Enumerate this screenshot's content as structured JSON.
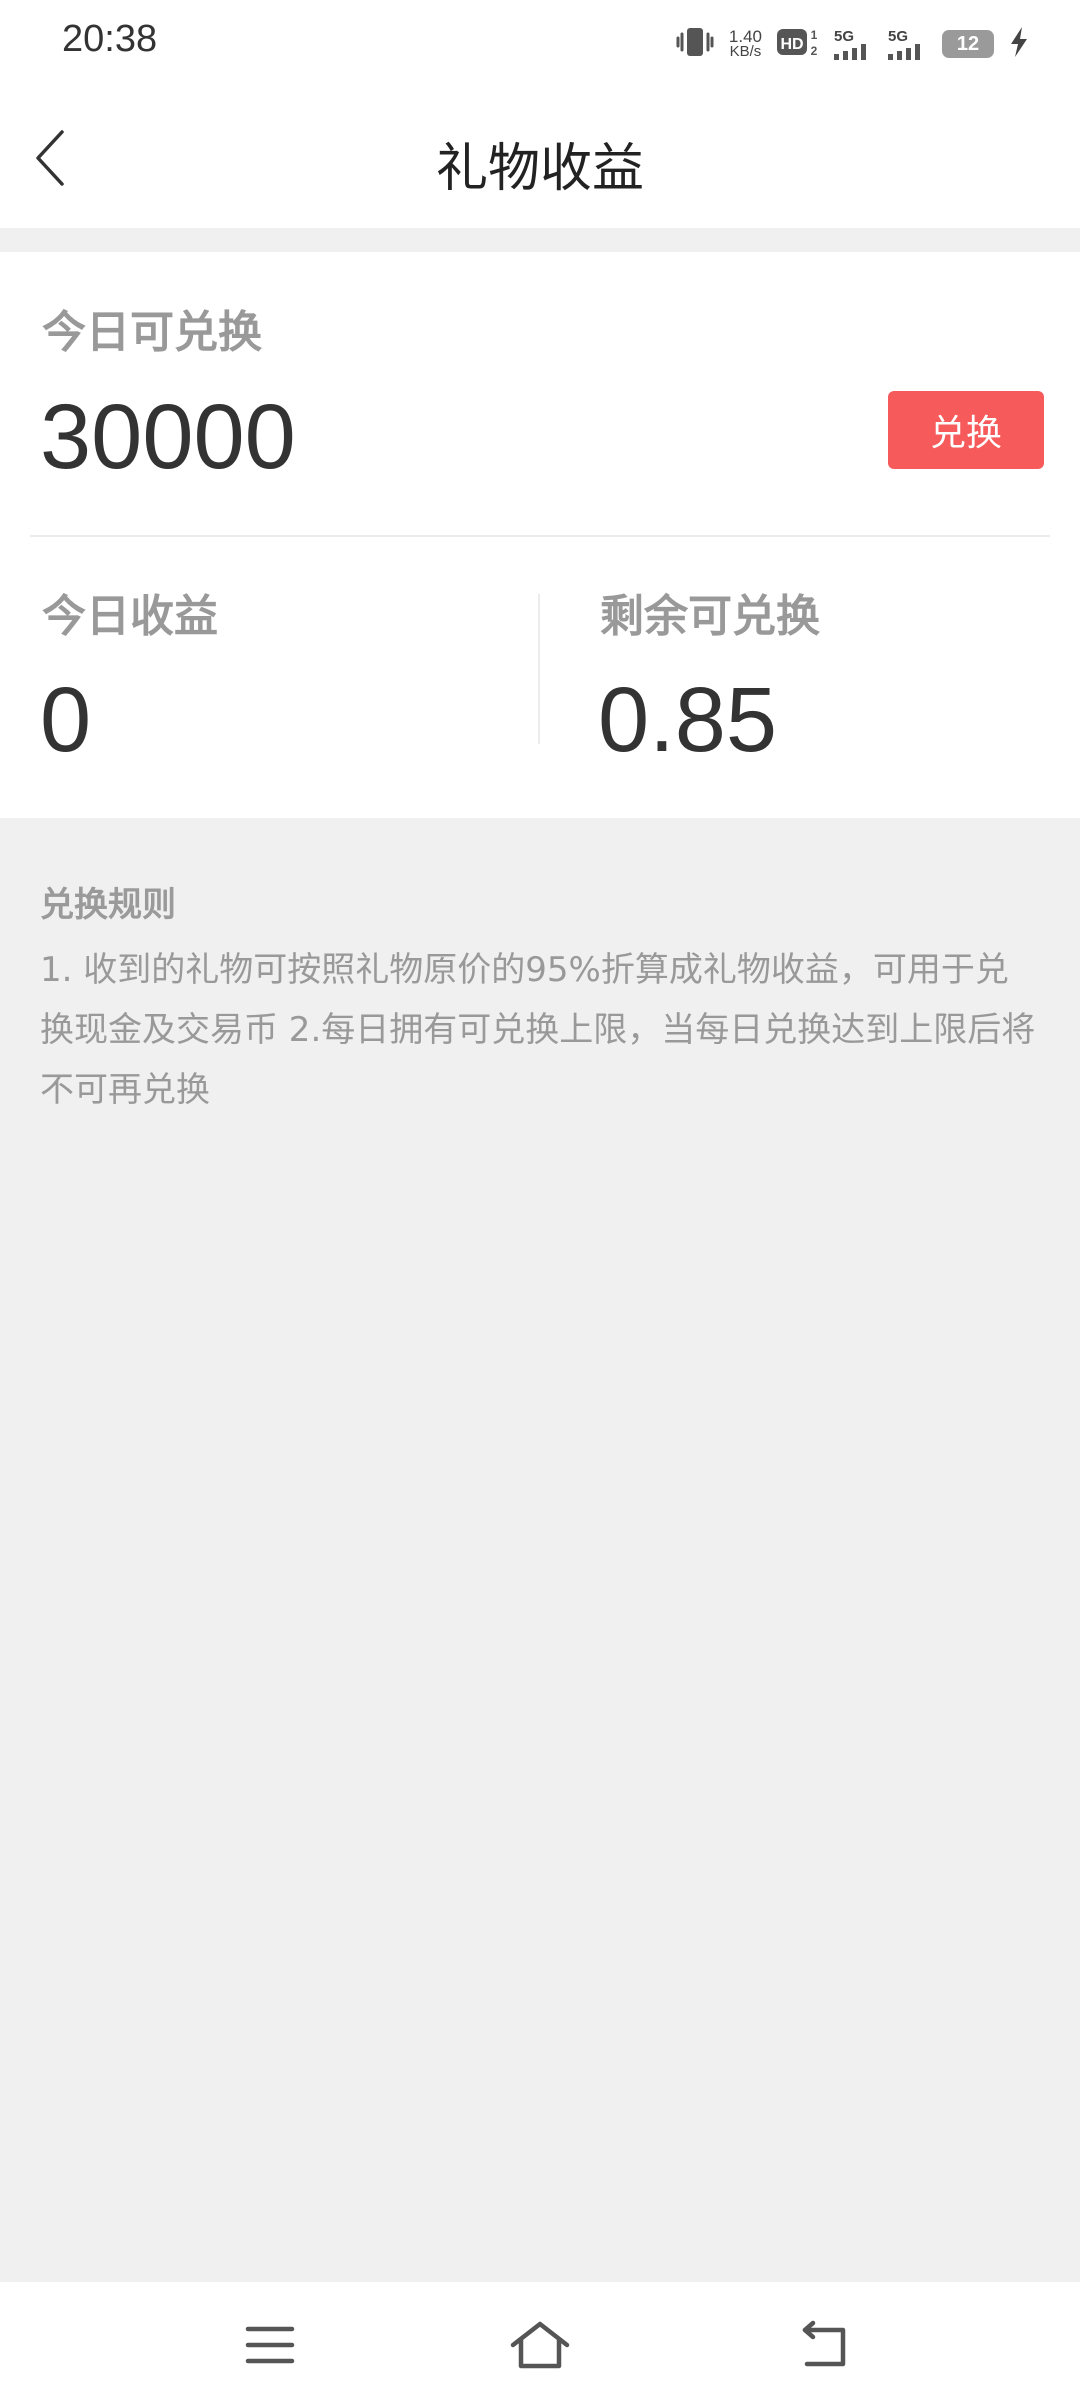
{
  "status_bar": {
    "time": "20:38",
    "net_speed_value": "1.40",
    "net_speed_unit": "KB/s",
    "hd_label": "HD",
    "sim1_label": "5G",
    "sim2_label": "5G",
    "battery_level": "12",
    "icons": [
      "vibrate-icon",
      "hd-icon",
      "signal-icon",
      "battery-icon",
      "charging-icon"
    ]
  },
  "header": {
    "title": "礼物收益",
    "back_icon": "chevron-left-icon"
  },
  "card": {
    "today_exchangeable_label": "今日可兑换",
    "today_exchangeable_value": "30000",
    "redeem_button_label": "兑换",
    "today_income_label": "今日收益",
    "today_income_value": "0",
    "remaining_label": "剩余可兑换",
    "remaining_value": "0.85"
  },
  "rules": {
    "title": "兑换规则",
    "text": "1. 收到的礼物可按照礼物原价的95%折算成礼物收益，可用于兑换现金及交易币 2.每日拥有可兑换上限，当每日兑换达到上限后将不可再兑换"
  },
  "nav": {
    "icons": [
      "menu-icon",
      "home-icon",
      "back-icon"
    ]
  },
  "colors": {
    "accent": "#f75a5a",
    "background": "#f0f0f0",
    "card": "#ffffff",
    "label": "#999999",
    "value": "#333333"
  }
}
